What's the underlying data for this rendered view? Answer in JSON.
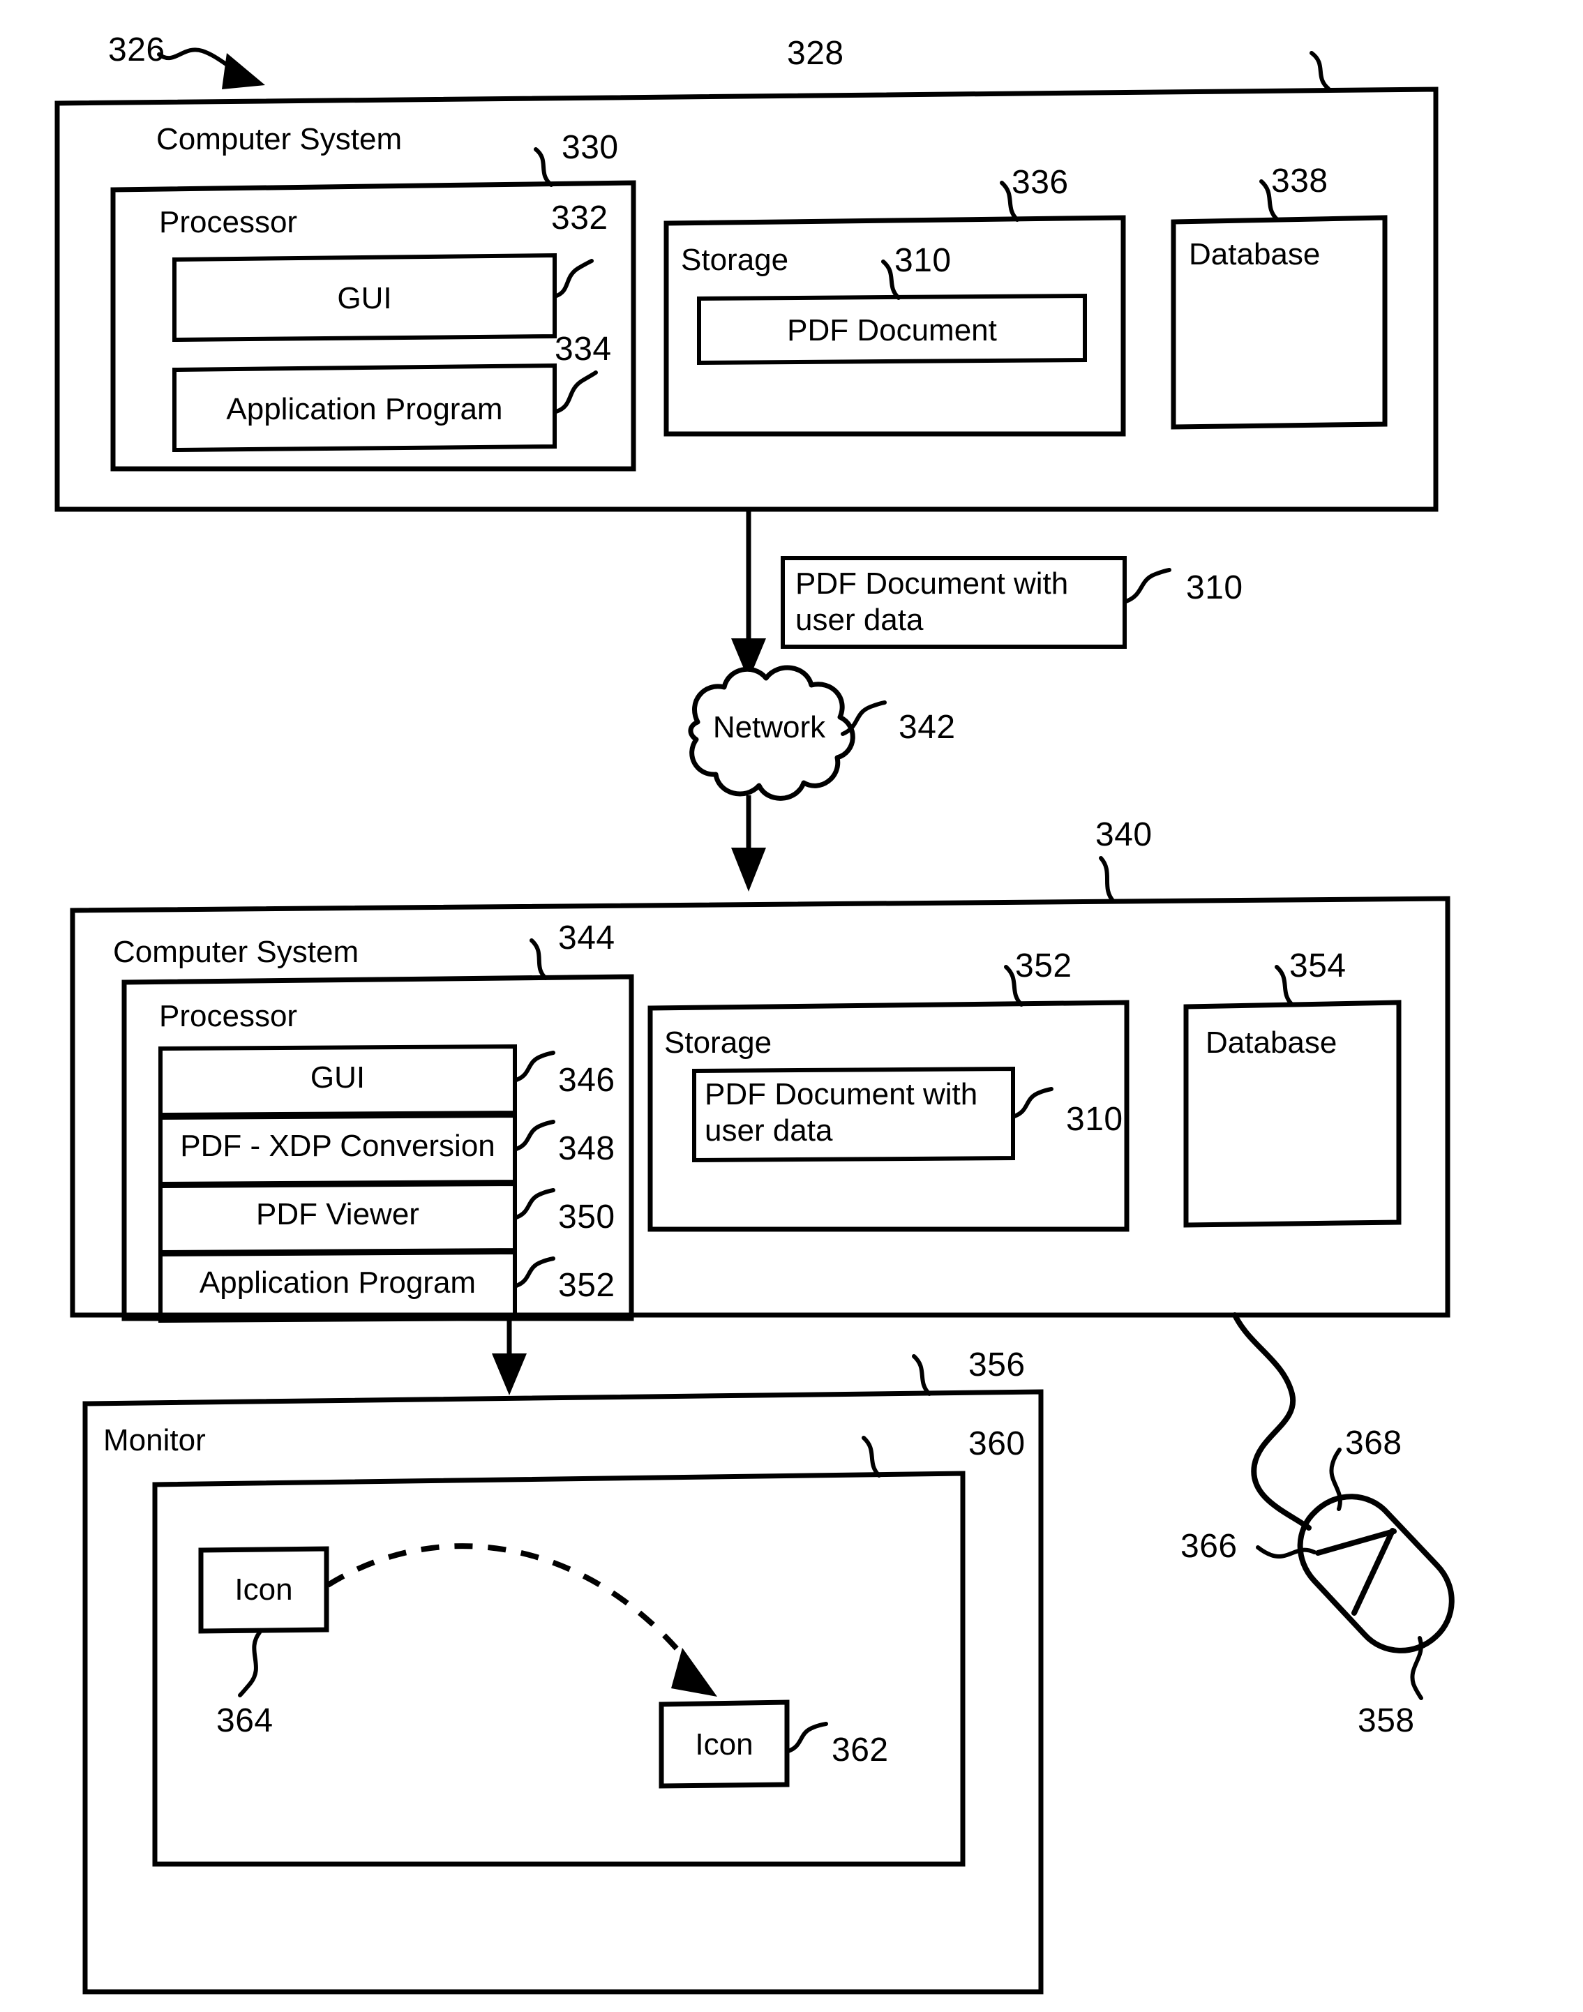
{
  "figure": {
    "type": "patent-block-diagram",
    "figure_ref": "326"
  },
  "refs": {
    "system_326": "326",
    "computer_system_328": "328",
    "processor_330": "330",
    "gui_332": "332",
    "application_program_334": "334",
    "storage_336": "336",
    "pdf_document_310": "310",
    "database_338": "338",
    "pdf_with_user_data_310": "310",
    "network_342": "342",
    "computer_system_340": "340",
    "processor_344": "344",
    "gui_346": "346",
    "pdf_xdp_conversion_348": "348",
    "pdf_viewer_350": "350",
    "application_program_352": "352",
    "storage_352": "352",
    "storage_pdf_310": "310",
    "database_354": "354",
    "monitor_356": "356",
    "screen_360": "360",
    "icon_source_364": "364",
    "icon_target_362": "362",
    "mouse_358": "358",
    "mouse_body_366": "366",
    "mouse_button_368": "368"
  },
  "top_system": {
    "title": "Computer System",
    "processor": {
      "title": "Processor",
      "modules": [
        {
          "label": "GUI"
        },
        {
          "label": "Application Program"
        }
      ]
    },
    "storage": {
      "title": "Storage",
      "items": [
        {
          "label": "PDF Document"
        }
      ]
    },
    "database": {
      "title": "Database"
    }
  },
  "transfer": {
    "payload_label": "PDF Document with\nuser data",
    "payload_line1": "PDF Document with",
    "payload_line2": "user data",
    "network_label": "Network"
  },
  "bottom_system": {
    "title": "Computer System",
    "processor": {
      "title": "Processor",
      "modules": [
        {
          "label": "GUI"
        },
        {
          "label": "PDF - XDP Conversion"
        },
        {
          "label": "PDF Viewer"
        },
        {
          "label": "Application Program"
        }
      ]
    },
    "storage": {
      "title": "Storage",
      "items": [
        {
          "line1": "PDF Document with",
          "line2": "user data"
        }
      ]
    },
    "database": {
      "title": "Database"
    }
  },
  "monitor": {
    "title": "Monitor",
    "icons": [
      {
        "label": "Icon"
      },
      {
        "label": "Icon"
      }
    ]
  },
  "colors": {
    "ink": "#000000",
    "paper": "#ffffff"
  }
}
